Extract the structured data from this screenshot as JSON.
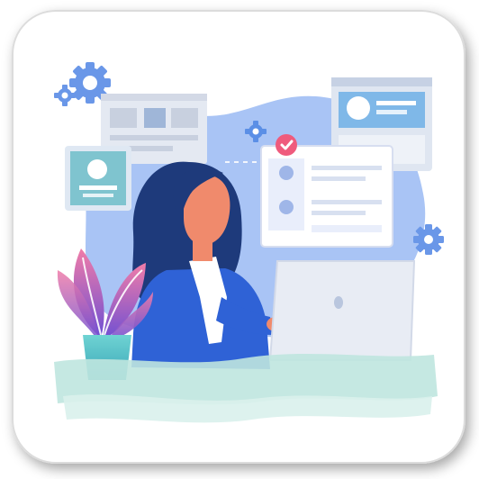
{
  "illustration": {
    "subject": "remote-work-illustration",
    "colors": {
      "background_blob": "#a9c4f5",
      "skin": "#f08a6c",
      "hair": "#1e3a7b",
      "shirt": "#2f62d6",
      "collar": "#ffffff",
      "laptop": "#e8ecf4",
      "desk": "#bfe6df",
      "plant_pot": "#4fc3c8",
      "plant_leaves": "#8f5ad6",
      "panel_blue": "#7fb8e8",
      "check_badge": "#ef5b7d",
      "gear": "#5b8fe6"
    },
    "icons": [
      "gear-icon",
      "check-icon",
      "avatar-icon",
      "laptop-icon",
      "plant-icon"
    ]
  }
}
